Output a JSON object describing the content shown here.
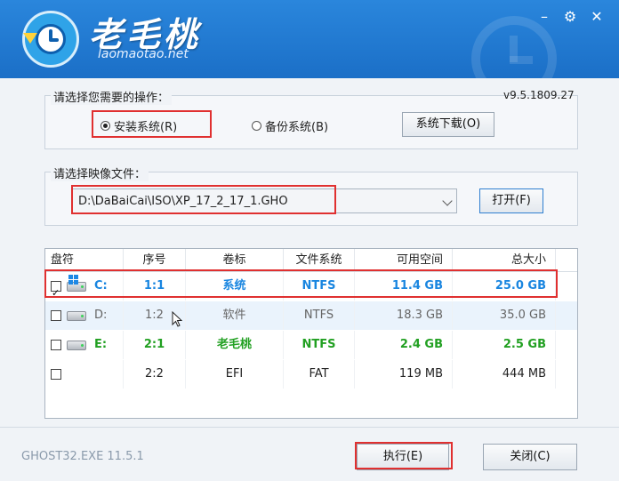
{
  "app": {
    "brand_title": "老毛桃",
    "brand_url": "laomaotao.net",
    "version": "v9.5.1809.27",
    "window_controls": {
      "minimize": "–",
      "close": "✕"
    }
  },
  "operation": {
    "group_label": "请选择您需要的操作：",
    "install_label": "安装系统(R)",
    "backup_label": "备份系统(B)",
    "download_label": "系统下载(O)",
    "selected": "install"
  },
  "image_file": {
    "group_label": "请选择映像文件：",
    "path": "D:\\DaBaiCai\\ISO\\XP_17_2_17_1.GHO",
    "open_label": "打开(F)"
  },
  "table": {
    "columns": [
      "盘符",
      "序号",
      "卷标",
      "文件系统",
      "可用空间",
      "总大小"
    ],
    "rows": [
      {
        "drive": "C:",
        "index": "1:1",
        "label": "系统",
        "fs": "NTFS",
        "free": "11.4 GB",
        "total": "25.0 GB",
        "checked": true,
        "color": "#1a86e0",
        "icon": "windows-drive-icon"
      },
      {
        "drive": "D:",
        "index": "1:2",
        "label": "软件",
        "fs": "NTFS",
        "free": "18.3 GB",
        "total": "35.0 GB",
        "checked": false,
        "color": "#666666",
        "icon": "hard-drive-icon"
      },
      {
        "drive": "E:",
        "index": "2:1",
        "label": "老毛桃",
        "fs": "NTFS",
        "free": "2.4 GB",
        "total": "2.5 GB",
        "checked": false,
        "color": "#22a022",
        "icon": "hard-drive-icon"
      },
      {
        "drive": "",
        "index": "2:2",
        "label": "EFI",
        "fs": "FAT",
        "free": "119 MB",
        "total": "444 MB",
        "checked": false,
        "color": "#222222",
        "icon": ""
      }
    ]
  },
  "footer": {
    "ghost_version": "GHOST32.EXE 11.5.1",
    "execute_label": "执行(E)",
    "close_label": "关闭(C)"
  }
}
